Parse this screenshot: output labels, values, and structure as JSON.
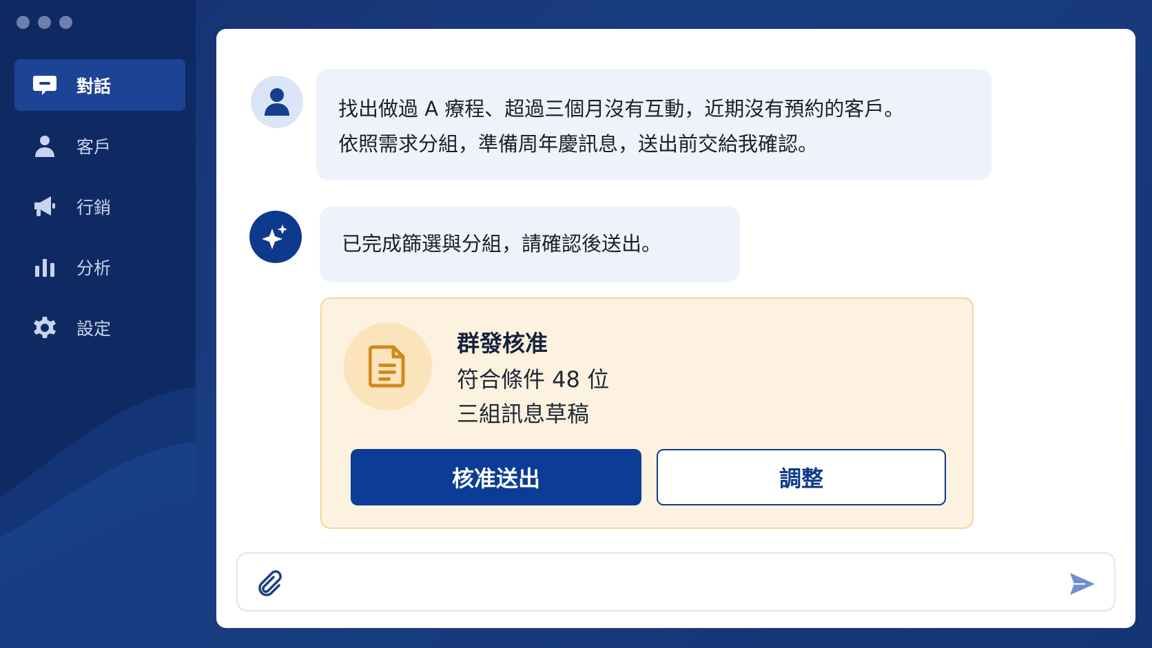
{
  "window": {
    "controls": [
      "close",
      "minimize",
      "maximize"
    ]
  },
  "sidebar": {
    "items": [
      {
        "label": "對話",
        "icon": "chat-icon",
        "active": true
      },
      {
        "label": "客戶",
        "icon": "person-icon",
        "active": false
      },
      {
        "label": "行銷",
        "icon": "megaphone-icon",
        "active": false
      },
      {
        "label": "分析",
        "icon": "bar-chart-icon",
        "active": false
      },
      {
        "label": "設定",
        "icon": "gear-icon",
        "active": false
      }
    ]
  },
  "chat": {
    "user_message": {
      "line1": "找出做過 A 療程、超過三個月沒有互動，近期沒有預約的客戶。",
      "line2": "依照需求分組，準備周年慶訊息，送出前交給我確認。"
    },
    "bot_message": "已完成篩選與分組，請確認後送出。",
    "approval_card": {
      "icon": "document-icon",
      "title": "群發核准",
      "detail1": "符合條件 48 位",
      "detail2": "三組訊息草稿",
      "approve_label": "核准送出",
      "adjust_label": "調整"
    }
  },
  "composer": {
    "placeholder": "",
    "attach_icon": "paperclip-icon",
    "send_icon": "send-icon"
  },
  "colors": {
    "sidebar_bg": "#0f2a63",
    "accent": "#0b3c96",
    "card_bg": "#fdf2df",
    "card_border": "#f4d49a"
  }
}
